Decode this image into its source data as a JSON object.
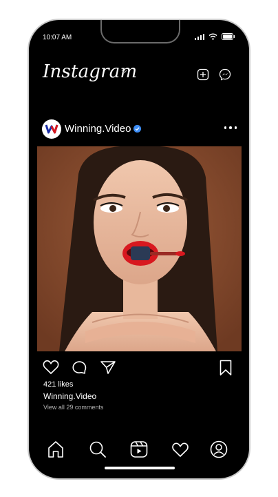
{
  "status": {
    "time": "10:07 AM"
  },
  "header": {
    "app_title": "Instagram"
  },
  "post": {
    "username": "Winning.Video",
    "likes": "421 likes",
    "caption_user": "Winning.Video",
    "comments_link": "View all 29 comments"
  },
  "icons": {
    "status": [
      "signal-icon",
      "wifi-icon",
      "battery-icon"
    ],
    "header": [
      "chevron-down-icon",
      "new-post-icon",
      "messenger-icon"
    ],
    "actions": [
      "heart-icon",
      "comment-icon",
      "share-icon",
      "bookmark-icon"
    ],
    "nav": [
      "home-icon",
      "search-icon",
      "reels-icon",
      "activity-icon",
      "profile-icon"
    ]
  },
  "colors": {
    "verified": "#3d8df5",
    "accent": "#d8181f",
    "background": "#000000"
  }
}
